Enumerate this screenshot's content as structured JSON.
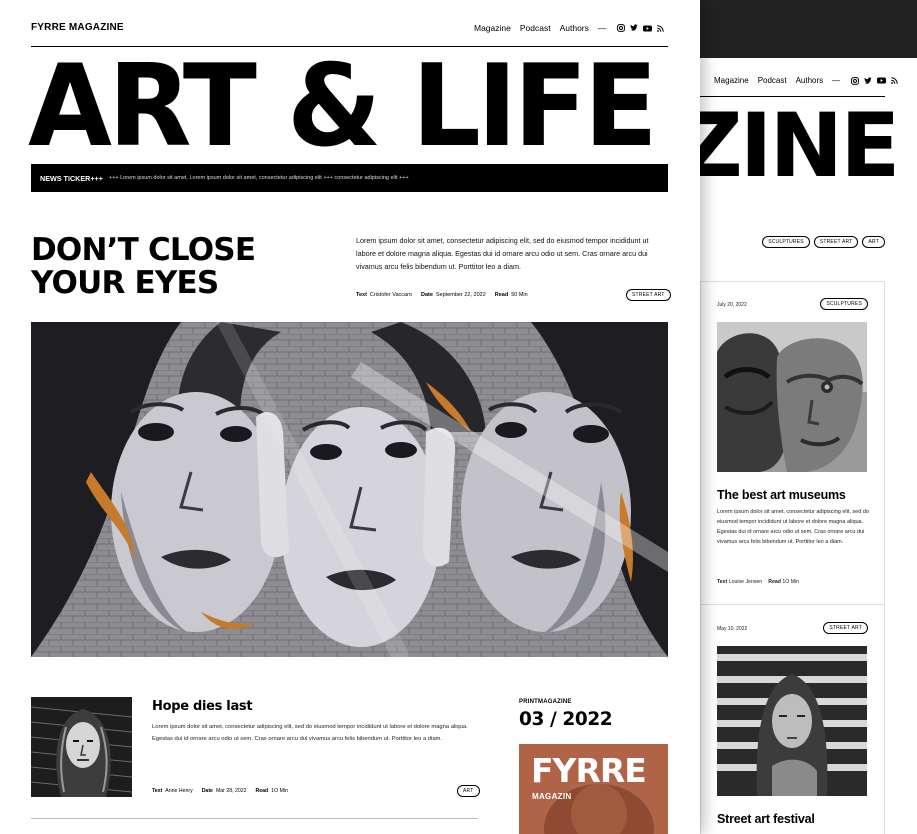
{
  "front": {
    "brand": "FYRRE MAGAZINE",
    "nav": [
      "Magazine",
      "Podcast",
      "Authors"
    ],
    "nav_dash": "—",
    "masthead": "ART & LIFE",
    "ticker": {
      "label": "NEWS TICKER+++",
      "text": "+++ Lorem ipsum dolor sit amet, Lorem ipsum dolor sit amet, consectetur adipiscing elit +++ consectetur adipiscing elit +++"
    },
    "featured": {
      "title": "DON’T CLOSE YOUR EYES",
      "lead": "Lorem ipsum dolor sit amet, consectetur adipiscing elit, sed do eiusmod tempor incididunt ut labore et dolore magna aliqua. Egestas dui id ornare arcu odio ut sem. Cras ornare arcu dui vivamus arcu felis bibendum ut. Porttitor leo a diam.",
      "meta": {
        "text_label": "Text",
        "author": "Cristofer Vaccaro",
        "date_label": "Date",
        "date": "September 22, 2022",
        "read_label": "Read",
        "read": "50 Min"
      },
      "tag": "STREET ART"
    },
    "article2": {
      "title": "Hope dies last",
      "body": "Lorem ipsum dolor sit amet, consectetur adipiscing elit, sed do eiusmod tempor incididunt ut labore et dolore magna aliqua. Egestas dui id ornare arcu odio ut sem. Cras ornare arcu dui vivamus arcu felis bibendum ut. Porttitor leo a diam.",
      "meta": {
        "text_label": "Text",
        "author": "Anne Henry",
        "date_label": "Date",
        "date": "Mar 28, 2022",
        "read_label": "Read",
        "read": "1O Min"
      },
      "tag": "ART"
    },
    "print": {
      "label": "PRINTMAGAZINE",
      "issue": "03 / 2022",
      "cover_title": "FYRRE",
      "cover_sub": "MAGAZIN"
    }
  },
  "back": {
    "nav": [
      "Magazine",
      "Podcast",
      "Authors"
    ],
    "nav_dash": "—",
    "masthead_fragment": "ZINE",
    "tags": [
      "SCULPTURES",
      "STREET ART",
      "ART"
    ],
    "card1": {
      "date": "July 20, 2022",
      "tag": "SCULPTURES",
      "title": "The best art museums",
      "body": "Lorem ipsum dolor sit amet, consectetur adipiscing elit, sed do eiusmod tempor incididunt ut labore et dolore magna aliqua. Egestas dui id ornare arcu odio ut sem. Cras ornare arcu dui vivamus arcu felis bibendum ut. Porttitor leo a diam.",
      "text_label": "Text",
      "author": "Louise Jensen",
      "read_label": "Read",
      "read": "1O Min"
    },
    "card2": {
      "date": "May 10, 2022",
      "tag": "STREET ART",
      "title": "Street art festival"
    }
  }
}
